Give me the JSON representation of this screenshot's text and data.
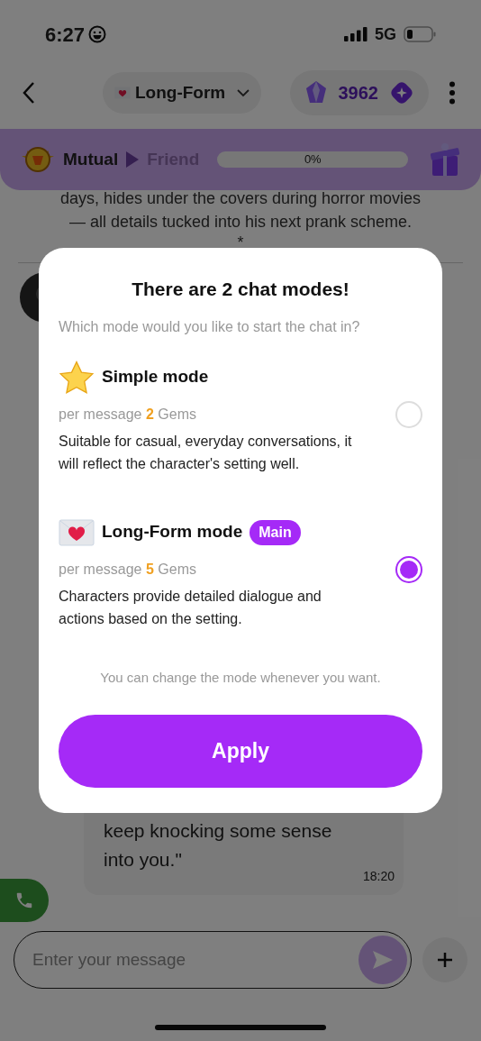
{
  "status_bar": {
    "time": "6:27",
    "network": "5G"
  },
  "header": {
    "mode_selector": {
      "label": "Long-Form"
    },
    "gems": "3962"
  },
  "relationship_bar": {
    "level": "Mutual",
    "next_level": "Friend",
    "progress": {
      "level": 0,
      "reading": "0%"
    }
  },
  "chat": {
    "narration": [
      "days, hides under the covers during horror movies",
      "— all details tucked into his next prank scheme.",
      "*"
    ],
    "message": {
      "lines": [
        "keep knocking some sense",
        "into you.\""
      ],
      "time": "18:20"
    }
  },
  "composer": {
    "placeholder": "Enter your message"
  },
  "dialog": {
    "title": "There are 2 chat modes!",
    "subtitle": "Which mode would you like to start the chat in?",
    "modes": [
      {
        "kind": "star",
        "name": "Simple mode",
        "cost": {
          "prefix": "per message",
          "amount": "2",
          "unit": "Gems"
        },
        "description": "Suitable for casual, everyday conversations, it will reflect the character's setting well.",
        "selected": false
      },
      {
        "kind": "letter",
        "name": "Long-Form mode",
        "badge": "Main",
        "cost": {
          "prefix": "per message",
          "amount": "5",
          "unit": "Gems"
        },
        "description": "Characters provide detailed dialogue and actions based on the setting.",
        "selected": true
      }
    ],
    "note": "You can change the mode whenever you want.",
    "button": "Apply"
  }
}
